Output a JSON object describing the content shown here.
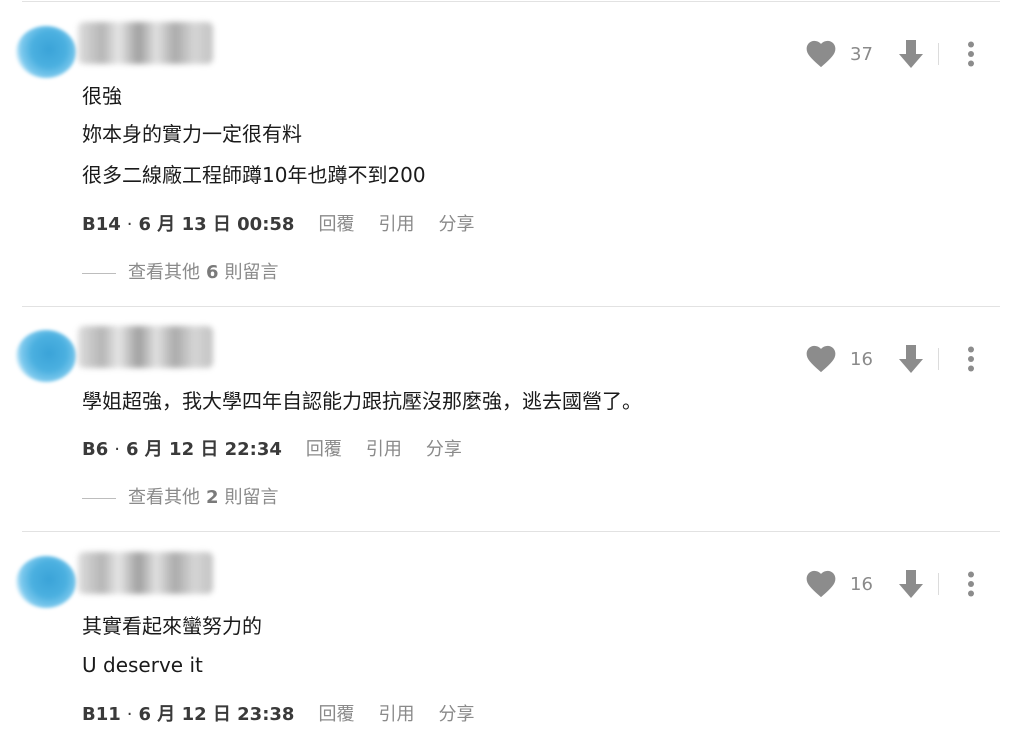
{
  "comments": [
    {
      "lines": [
        "很強",
        "妳本身的實力一定很有料",
        "很多二線廠工程師蹲10年也蹲不到200"
      ],
      "floor": "B14",
      "date": "6 月 13 日 00:58",
      "likes": "37",
      "reply_label": "回覆",
      "quote_label": "引用",
      "share_label": "分享",
      "more": {
        "prefix": "查看其他",
        "count": "6",
        "suffix": "則留言"
      }
    },
    {
      "lines": [
        "學姐超強，我大學四年自認能力跟抗壓沒那麼強，逃去國營了。"
      ],
      "floor": "B6",
      "date": "6 月 12 日 22:34",
      "likes": "16",
      "reply_label": "回覆",
      "quote_label": "引用",
      "share_label": "分享",
      "more": {
        "prefix": "查看其他",
        "count": "2",
        "suffix": "則留言"
      }
    },
    {
      "lines": [
        "其實看起來蠻努力的",
        "U deserve it"
      ],
      "floor": "B11",
      "date": "6 月 12 日 23:38",
      "likes": "16",
      "reply_label": "回覆",
      "quote_label": "引用",
      "share_label": "分享"
    }
  ],
  "icons": {
    "like": "heart-icon",
    "dislike": "arrow-down-icon",
    "more": "more-vertical-icon"
  },
  "colors": {
    "icon": "#8c8c8c",
    "muted_text": "#8a8a8a",
    "divider": "#e2e2e2",
    "avatar": "#3aa3d8"
  }
}
